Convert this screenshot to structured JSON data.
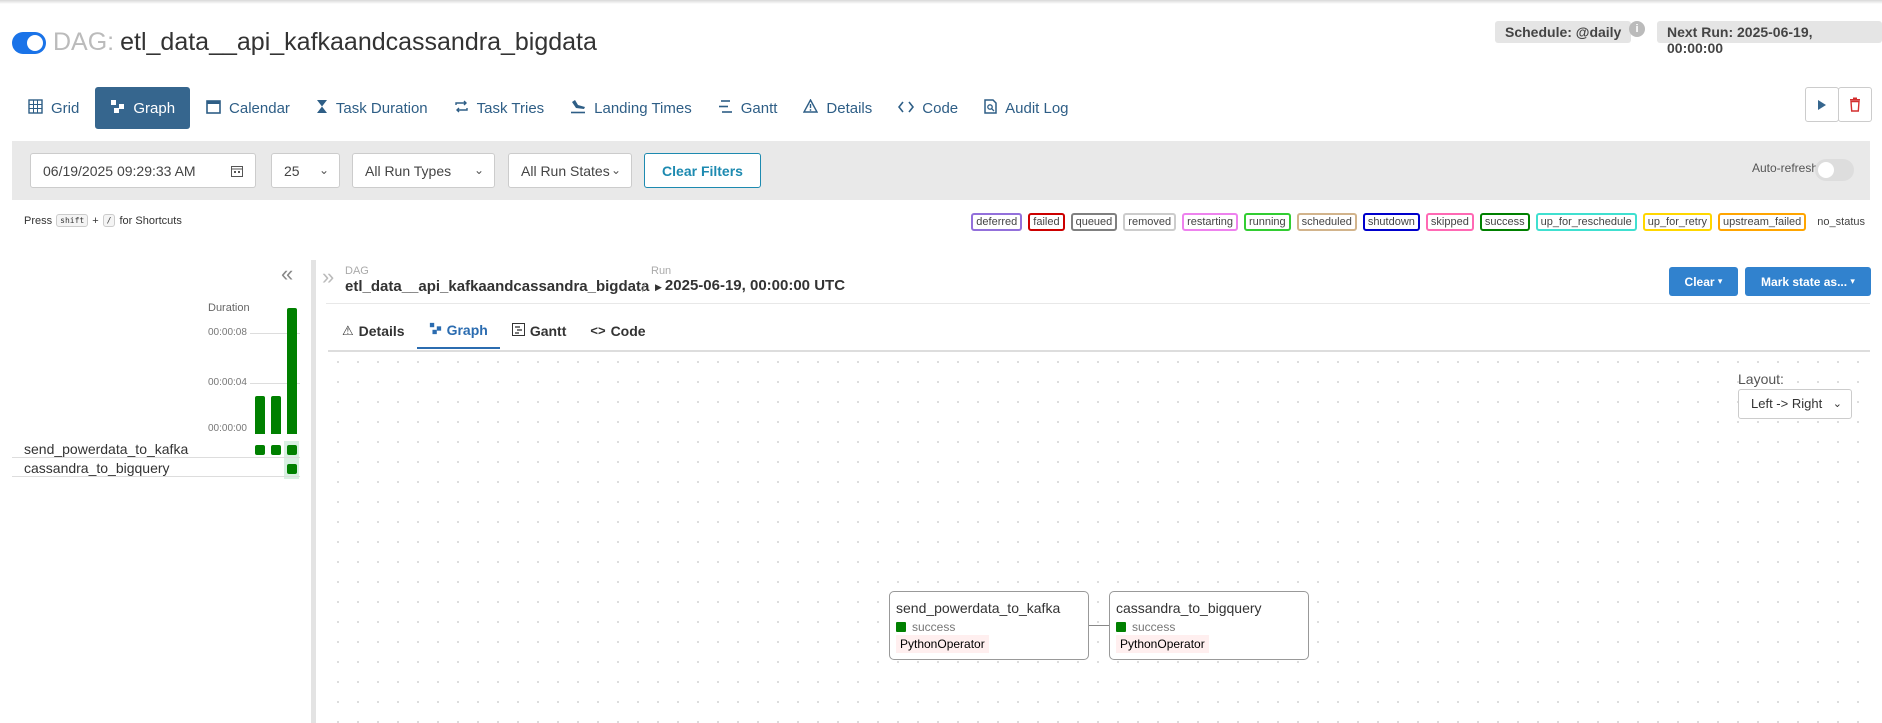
{
  "dag": {
    "prefix": "DAG:",
    "name": "etl_data__api_kafkaandcassandra_bigdata",
    "schedule": "Schedule: @daily",
    "info": "i",
    "next_run": "Next Run: 2025-06-19, 00:00:00"
  },
  "nav_tabs": [
    {
      "label": "Grid",
      "icon": "grid-icon"
    },
    {
      "label": "Graph",
      "icon": "graph-icon",
      "active": true
    },
    {
      "label": "Calendar",
      "icon": "calendar-icon"
    },
    {
      "label": "Task Duration",
      "icon": "hourglass-icon"
    },
    {
      "label": "Task Tries",
      "icon": "repeat-icon"
    },
    {
      "label": "Landing Times",
      "icon": "landing-icon"
    },
    {
      "label": "Gantt",
      "icon": "gantt-icon"
    },
    {
      "label": "Details",
      "icon": "warning-icon"
    },
    {
      "label": "Code",
      "icon": "code-icon"
    },
    {
      "label": "Audit Log",
      "icon": "audit-icon"
    }
  ],
  "filters": {
    "date": "06/19/2025 09:29:33 AM",
    "num_runs": "25",
    "run_types": "All Run Types",
    "run_states": "All Run States",
    "clear_label": "Clear Filters",
    "auto_refresh": "Auto-refresh"
  },
  "shortcuts": {
    "press": "Press",
    "key1": "shift",
    "plus": "+",
    "key2": "/",
    "suffix": "for Shortcuts"
  },
  "legend": [
    {
      "label": "deferred",
      "color": "#9370db"
    },
    {
      "label": "failed",
      "color": "#cc0000"
    },
    {
      "label": "queued",
      "color": "#808080"
    },
    {
      "label": "removed",
      "color": "#cccccc"
    },
    {
      "label": "restarting",
      "color": "#ee82ee"
    },
    {
      "label": "running",
      "color": "#32cd32"
    },
    {
      "label": "scheduled",
      "color": "#d2b48c"
    },
    {
      "label": "shutdown",
      "color": "#0000cc"
    },
    {
      "label": "skipped",
      "color": "#ff69b4"
    },
    {
      "label": "success",
      "color": "#008000"
    },
    {
      "label": "up_for_reschedule",
      "color": "#40e0d0"
    },
    {
      "label": "up_for_retry",
      "color": "#ffd700"
    },
    {
      "label": "upstream_failed",
      "color": "#ffa500"
    },
    {
      "label": "no_status",
      "color": "none"
    }
  ],
  "grid": {
    "duration_label": "Duration",
    "ticks": [
      "00:00:08",
      "00:00:04",
      "00:00:00"
    ],
    "run_durations_sec": [
      3,
      3,
      10
    ],
    "tasks": [
      "send_powerdata_to_kafka",
      "cassandra_to_bigquery"
    ]
  },
  "detail": {
    "dag_small": "DAG",
    "dag_name": "etl_data__api_kafkaandcassandra_bigdata",
    "sep": "/",
    "run_small": "Run",
    "run_name": "2025-06-19, 00:00:00 UTC",
    "clear_btn": "Clear",
    "mark_btn": "Mark state as...",
    "tabs": [
      "Details",
      "Graph",
      "Gantt",
      "Code"
    ],
    "layout_label": "Layout:",
    "layout_value": "Left -> Right"
  },
  "nodes": [
    {
      "name": "send_powerdata_to_kafka",
      "state": "success",
      "operator": "PythonOperator"
    },
    {
      "name": "cassandra_to_bigquery",
      "state": "success",
      "operator": "PythonOperator"
    }
  ],
  "colors": {
    "success": "#008000",
    "primary": "#36668e",
    "button_blue": "#3182ce"
  }
}
